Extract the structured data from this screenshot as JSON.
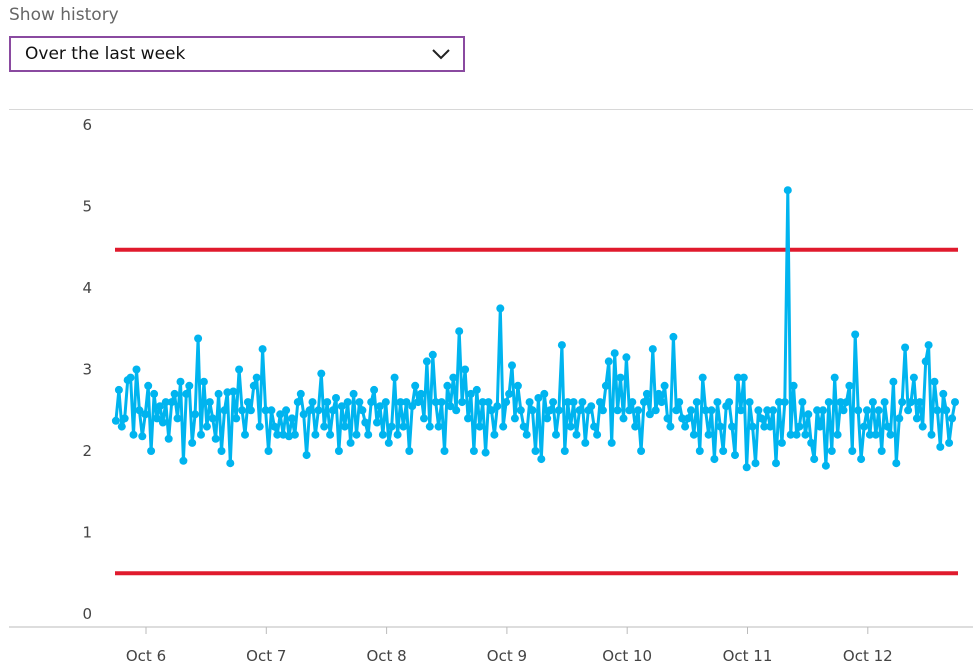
{
  "history": {
    "label": "Show history",
    "selected": "Over the last week"
  },
  "icons": {
    "dropdown": "chevron-down-icon"
  },
  "colors": {
    "series": "#00b4ef",
    "threshold": "#e01a2d",
    "dropdown_border": "#8a4aa0"
  },
  "chart_data": {
    "type": "line",
    "title": "",
    "xlabel": "",
    "ylabel": "",
    "ylim": [
      0,
      6
    ],
    "yticks": [
      "0",
      "1",
      "2",
      "3",
      "4",
      "5",
      "6"
    ],
    "xticks": [
      "Oct 6",
      "Oct 7",
      "Oct 8",
      "Oct 9",
      "Oct 10",
      "Oct 11",
      "Oct 12"
    ],
    "x_start_day": 5.75,
    "x_step_days": 0.0208,
    "thresholds": [
      4.47,
      0.5
    ],
    "series": [
      {
        "values": [
          2.37,
          2.75,
          2.3,
          2.4,
          2.87,
          2.9,
          2.2,
          3.0,
          2.5,
          2.18,
          2.45,
          2.8,
          2.0,
          2.7,
          2.4,
          2.55,
          2.35,
          2.6,
          2.15,
          2.6,
          2.7,
          2.4,
          2.85,
          1.88,
          2.7,
          2.8,
          2.1,
          2.45,
          3.38,
          2.2,
          2.85,
          2.3,
          2.6,
          2.4,
          2.15,
          2.7,
          2.0,
          2.5,
          2.72,
          1.85,
          2.73,
          2.4,
          3.0,
          2.5,
          2.2,
          2.6,
          2.5,
          2.8,
          2.9,
          2.3,
          3.25,
          2.5,
          2.0,
          2.5,
          2.3,
          2.2,
          2.45,
          2.2,
          2.5,
          2.18,
          2.4,
          2.2,
          2.6,
          2.7,
          2.45,
          1.95,
          2.5,
          2.6,
          2.2,
          2.5,
          2.95,
          2.3,
          2.6,
          2.2,
          2.5,
          2.65,
          2.0,
          2.55,
          2.3,
          2.6,
          2.1,
          2.7,
          2.2,
          2.6,
          2.5,
          2.35,
          2.2,
          2.6,
          2.75,
          2.35,
          2.55,
          2.2,
          2.6,
          2.1,
          2.3,
          2.9,
          2.2,
          2.6,
          2.3,
          2.6,
          2.0,
          2.55,
          2.8,
          2.6,
          2.7,
          2.4,
          3.1,
          2.3,
          3.18,
          2.6,
          2.3,
          2.6,
          2.0,
          2.8,
          2.55,
          2.9,
          2.5,
          3.47,
          2.6,
          3.0,
          2.4,
          2.7,
          2.0,
          2.75,
          2.3,
          2.6,
          1.98,
          2.6,
          2.5,
          2.2,
          2.55,
          3.75,
          2.3,
          2.6,
          2.7,
          3.05,
          2.4,
          2.8,
          2.5,
          2.3,
          2.2,
          2.6,
          2.5,
          2.0,
          2.65,
          1.9,
          2.7,
          2.4,
          2.5,
          2.6,
          2.2,
          2.5,
          3.3,
          2.0,
          2.6,
          2.3,
          2.6,
          2.2,
          2.5,
          2.6,
          2.1,
          2.5,
          2.55,
          2.3,
          2.2,
          2.6,
          2.5,
          2.8,
          3.1,
          2.1,
          3.2,
          2.5,
          2.9,
          2.4,
          3.15,
          2.5,
          2.6,
          2.3,
          2.5,
          2.0,
          2.6,
          2.7,
          2.45,
          3.25,
          2.5,
          2.7,
          2.6,
          2.8,
          2.4,
          2.3,
          3.4,
          2.5,
          2.6,
          2.4,
          2.3,
          2.4,
          2.5,
          2.2,
          2.6,
          2.0,
          2.9,
          2.5,
          2.2,
          2.5,
          1.9,
          2.6,
          2.3,
          2.0,
          2.55,
          2.6,
          2.3,
          1.95,
          2.9,
          2.5,
          2.9,
          1.8,
          2.6,
          2.3,
          1.85,
          2.5,
          2.4,
          2.3,
          2.5,
          2.3,
          2.5,
          1.85,
          2.6,
          2.1,
          2.6,
          5.2,
          2.2,
          2.8,
          2.2,
          2.3,
          2.6,
          2.2,
          2.45,
          2.1,
          1.9,
          2.5,
          2.3,
          2.5,
          1.82,
          2.6,
          2.0,
          2.9,
          2.2,
          2.6,
          2.5,
          2.6,
          2.8,
          2.0,
          3.43,
          2.5,
          1.9,
          2.3,
          2.5,
          2.2,
          2.6,
          2.2,
          2.5,
          2.0,
          2.6,
          2.3,
          2.2,
          2.85,
          1.85,
          2.4,
          2.6,
          3.27,
          2.5,
          2.6,
          2.9,
          2.4,
          2.6,
          2.3,
          3.1,
          3.3,
          2.2,
          2.85,
          2.5,
          2.05,
          2.7,
          2.5,
          2.1,
          2.4,
          2.6
        ]
      }
    ],
    "grid": false,
    "legend": "none"
  }
}
